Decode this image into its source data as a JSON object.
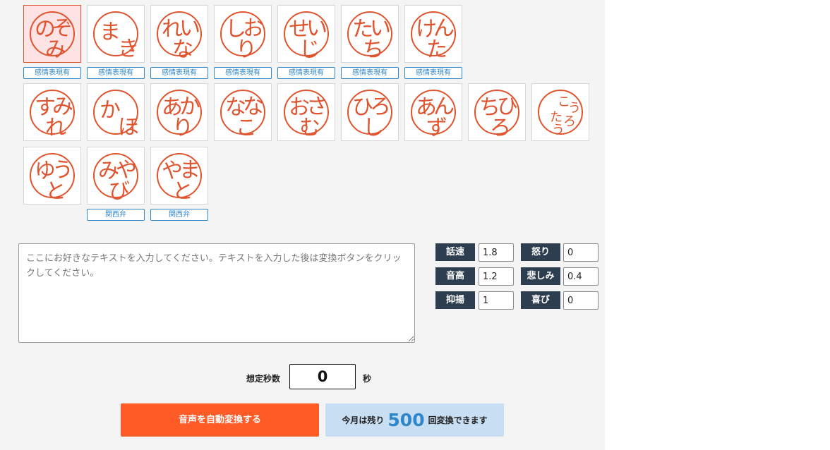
{
  "voices": {
    "row1": [
      {
        "chars": [
          "の",
          "ぞ",
          "み"
        ],
        "badge": "感情表現有",
        "selected": true
      },
      {
        "chars": [
          "ま",
          "き"
        ],
        "badge": "感情表現有"
      },
      {
        "chars": [
          "れ",
          "い",
          "な"
        ],
        "badge": "感情表現有"
      },
      {
        "chars": [
          "し",
          "お",
          "り"
        ],
        "badge": "感情表現有"
      },
      {
        "chars": [
          "せ",
          "い",
          "じ"
        ],
        "badge": "感情表現有"
      },
      {
        "chars": [
          "た",
          "い",
          "ち"
        ],
        "badge": "感情表現有"
      },
      {
        "chars": [
          "け",
          "ん",
          "た"
        ],
        "badge": "感情表現有"
      }
    ],
    "row2": [
      {
        "chars": [
          "す",
          "み",
          "れ"
        ]
      },
      {
        "chars": [
          "か",
          "ほ"
        ]
      },
      {
        "chars": [
          "あ",
          "か",
          "り"
        ]
      },
      {
        "chars": [
          "な",
          "な",
          "こ"
        ]
      },
      {
        "chars": [
          "お",
          "さ",
          "む"
        ]
      },
      {
        "chars": [
          "ひ",
          "ろ",
          "し"
        ]
      },
      {
        "chars": [
          "あ",
          "ん",
          "ず"
        ]
      },
      {
        "chars": [
          "ち",
          "ひ",
          "ろ"
        ]
      },
      {
        "chars": [
          "こ",
          "う",
          "た",
          "ろ",
          "う"
        ]
      }
    ],
    "row3": [
      {
        "chars": [
          "ゆ",
          "う",
          "と"
        ]
      },
      {
        "chars": [
          "み",
          "や",
          "び"
        ],
        "badge": "関西弁"
      },
      {
        "chars": [
          "や",
          "ま",
          "と"
        ],
        "badge": "関西弁"
      }
    ]
  },
  "text_input": {
    "placeholder": "ここにお好きなテキストを入力してください。テキストを入力した後は変換ボタンをクリックしてください。"
  },
  "params": {
    "speed": {
      "label": "話速",
      "value": "1.8"
    },
    "pitch": {
      "label": "音高",
      "value": "1.2"
    },
    "intonation": {
      "label": "抑揚",
      "value": "1"
    },
    "anger": {
      "label": "怒り",
      "value": "0"
    },
    "sadness": {
      "label": "悲しみ",
      "value": "0.4"
    },
    "joy": {
      "label": "喜び",
      "value": "0"
    }
  },
  "duration": {
    "label": "想定秒数",
    "value": "0",
    "unit": "秒"
  },
  "convert_button": {
    "label": "音声を自動変換する"
  },
  "remaining": {
    "prefix": "今月は残り",
    "count": "500",
    "suffix": "回変換できます"
  },
  "colors": {
    "accent": "#fe5b27",
    "stamp": "#e0552f",
    "badge": "#2f86c9",
    "param_label_bg": "#2c3e50",
    "remaining_bg": "#c8def2"
  }
}
